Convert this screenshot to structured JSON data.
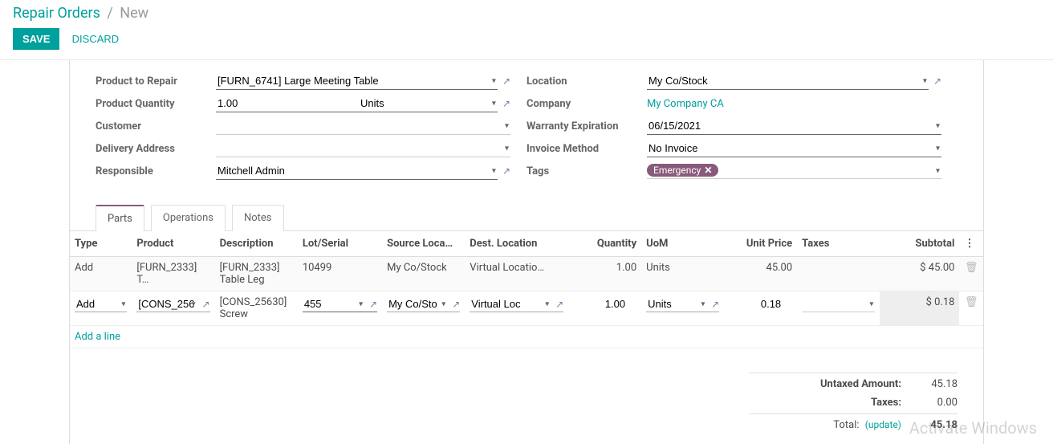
{
  "breadcrumb": {
    "root": "Repair Orders",
    "current": "New"
  },
  "actions": {
    "save": "SAVE",
    "discard": "DISCARD"
  },
  "form": {
    "left": {
      "product_to_repair_label": "Product to Repair",
      "product_to_repair": "[FURN_6741] Large Meeting Table",
      "product_quantity_label": "Product Quantity",
      "product_quantity": "1.00",
      "product_uom": "Units",
      "customer_label": "Customer",
      "customer": "",
      "delivery_label": "Delivery Address",
      "delivery": "",
      "responsible_label": "Responsible",
      "responsible": "Mitchell Admin"
    },
    "right": {
      "location_label": "Location",
      "location": "My Co/Stock",
      "company_label": "Company",
      "company": "My Company CA",
      "warranty_label": "Warranty Expiration",
      "warranty": "06/15/2021",
      "invoice_label": "Invoice Method",
      "invoice": "No Invoice",
      "tags_label": "Tags",
      "tag": "Emergency"
    }
  },
  "tabs": {
    "parts": "Parts",
    "operations": "Operations",
    "notes": "Notes"
  },
  "columns": {
    "type": "Type",
    "product": "Product",
    "description": "Description",
    "lot": "Lot/Serial",
    "src": "Source Loca…",
    "dest": "Dest. Location",
    "qty": "Quantity",
    "uom": "UoM",
    "price": "Unit Price",
    "tax": "Taxes",
    "sub": "Subtotal"
  },
  "rows": [
    {
      "type": "Add",
      "product": "[FURN_2333] T…",
      "description": "[FURN_2333] Table Leg",
      "lot": "10499",
      "src": "My Co/Stock",
      "dest": "Virtual Locatio…",
      "qty": "1.00",
      "uom": "Units",
      "price": "45.00",
      "tax": "",
      "sub": "$ 45.00"
    },
    {
      "type": "Add",
      "product": "[CONS_256",
      "description": "[CONS_25630] Screw",
      "lot": "455",
      "src": "My Co/Sto",
      "dest": "Virtual Loc",
      "qty": "1.00",
      "uom": "Units",
      "price": "0.18",
      "tax": "",
      "sub": "$ 0.18"
    }
  ],
  "add_line": "Add a line",
  "totals": {
    "untaxed_label": "Untaxed Amount:",
    "untaxed": "45.18",
    "taxes_label": "Taxes:",
    "taxes": "0.00",
    "total_label": "Total:",
    "update": "(update)",
    "total": "45.18"
  },
  "watermark": "Activate Windows"
}
